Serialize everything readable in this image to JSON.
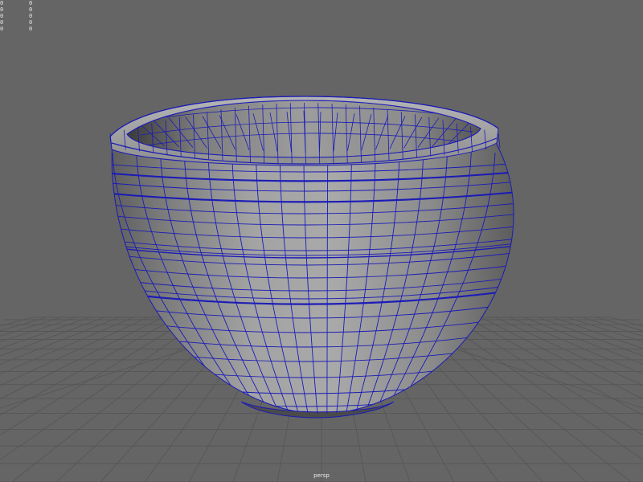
{
  "viewport": {
    "camera_name": "persp",
    "background_color": "#656565",
    "wireframe_color": "#1a1ab8",
    "grid_color": "#555555"
  },
  "hud": {
    "rows": [
      {
        "label": "0",
        "value": "0"
      },
      {
        "label": "0",
        "value": "0"
      },
      {
        "label": "0",
        "value": "0"
      },
      {
        "label": "0",
        "value": "0"
      },
      {
        "label": "0",
        "value": "0"
      }
    ]
  },
  "scene": {
    "object": "bowl-mesh",
    "display_mode": "smooth shade with wireframe on shaded"
  }
}
